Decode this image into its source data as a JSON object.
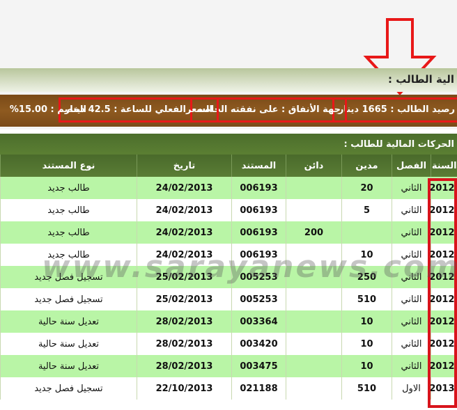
{
  "section_title": "الية الطالب :",
  "summary": {
    "balance": "رصيد الطالب : 1665 دينار",
    "funding": "جهة الأنفاق : على نفقته الخاصه",
    "rate": "السعرالفعلي للساعة : 42.5 دينار",
    "discount": "الخصم : 15.00%"
  },
  "moves_title": "الحركات المالية للطالب :",
  "table": {
    "headers": [
      "السنة",
      "الفصل",
      "مدين",
      "دائن",
      "المستند",
      "تاريخ",
      "نوع المستند"
    ],
    "rows": [
      {
        "year": "2012",
        "term": "الثاني",
        "debit": "20",
        "credit": "",
        "doc": "006193",
        "date": "24/02/2013",
        "type": "طالب جديد"
      },
      {
        "year": "2012",
        "term": "الثاني",
        "debit": "5",
        "credit": "",
        "doc": "006193",
        "date": "24/02/2013",
        "type": "طالب جديد"
      },
      {
        "year": "2012",
        "term": "الثاني",
        "debit": "",
        "credit": "200",
        "doc": "006193",
        "date": "24/02/2013",
        "type": "طالب جديد"
      },
      {
        "year": "2012",
        "term": "الثاني",
        "debit": "10",
        "credit": "",
        "doc": "006193",
        "date": "24/02/2013",
        "type": "طالب جديد"
      },
      {
        "year": "2012",
        "term": "الثاني",
        "debit": "250",
        "credit": "",
        "doc": "005253",
        "date": "25/02/2013",
        "type": "تسجيل فصل جديد"
      },
      {
        "year": "2012",
        "term": "الثاني",
        "debit": "510",
        "credit": "",
        "doc": "005253",
        "date": "25/02/2013",
        "type": "تسجيل فصل جديد"
      },
      {
        "year": "2012",
        "term": "الثاني",
        "debit": "10",
        "credit": "",
        "doc": "003364",
        "date": "28/02/2013",
        "type": "تعديل سنة حالية"
      },
      {
        "year": "2012",
        "term": "الثاني",
        "debit": "10",
        "credit": "",
        "doc": "003420",
        "date": "28/02/2013",
        "type": "تعديل سنة حالية"
      },
      {
        "year": "2012",
        "term": "الثاني",
        "debit": "10",
        "credit": "",
        "doc": "003475",
        "date": "28/02/2013",
        "type": "تعديل سنة حالية"
      },
      {
        "year": "2013",
        "term": "الاول",
        "debit": "510",
        "credit": "",
        "doc": "021188",
        "date": "22/10/2013",
        "type": "تسجيل فصل جديد"
      }
    ]
  },
  "watermark": "www.sarayanews.com",
  "colors": {
    "highlight": "#e81818",
    "header_green": "#4a6a2b",
    "row_green": "#b9f5a6",
    "summary_brown": "#8e5a20"
  }
}
